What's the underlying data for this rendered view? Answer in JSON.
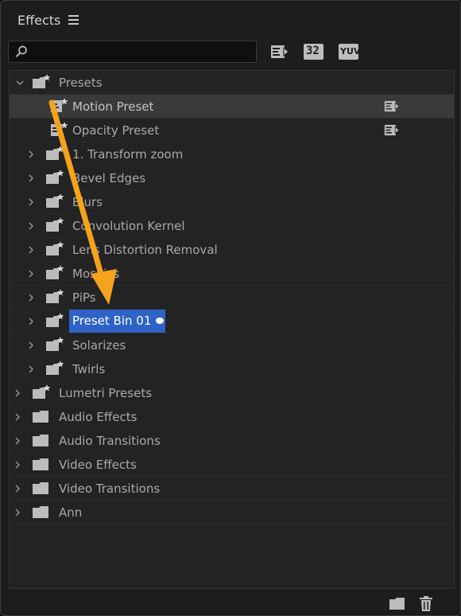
{
  "panel": {
    "title": "Effects"
  },
  "search": {
    "value": "",
    "placeholder": ""
  },
  "toolbar": {
    "accelerated_label": "",
    "bit32_label": "32",
    "yuv_label": "YUV"
  },
  "tree": {
    "presets": {
      "label": "Presets",
      "motion_preset": "Motion Preset",
      "opacity_preset": "Opacity Preset",
      "bins": [
        "1. Transform zoom",
        "Bevel Edges",
        "Blurs",
        "Convolution Kernel",
        "Lens Distortion Removal",
        "Mosaics",
        "PiPs",
        "Preset Bin 01",
        "Solarizes",
        "Twirls"
      ]
    },
    "top_level": [
      "Lumetri Presets",
      "Audio Effects",
      "Audio Transitions",
      "Video Effects",
      "Video Transitions",
      "Ann"
    ]
  },
  "colors": {
    "selection": "#2e62c6",
    "annotation_arrow": "#f5a31a"
  },
  "icons": {
    "search": "search-icon",
    "menu": "hamburger-menu-icon",
    "accelerated": "accelerated-effects-icon",
    "new_bin": "new-folder-icon",
    "delete": "trash-icon"
  }
}
